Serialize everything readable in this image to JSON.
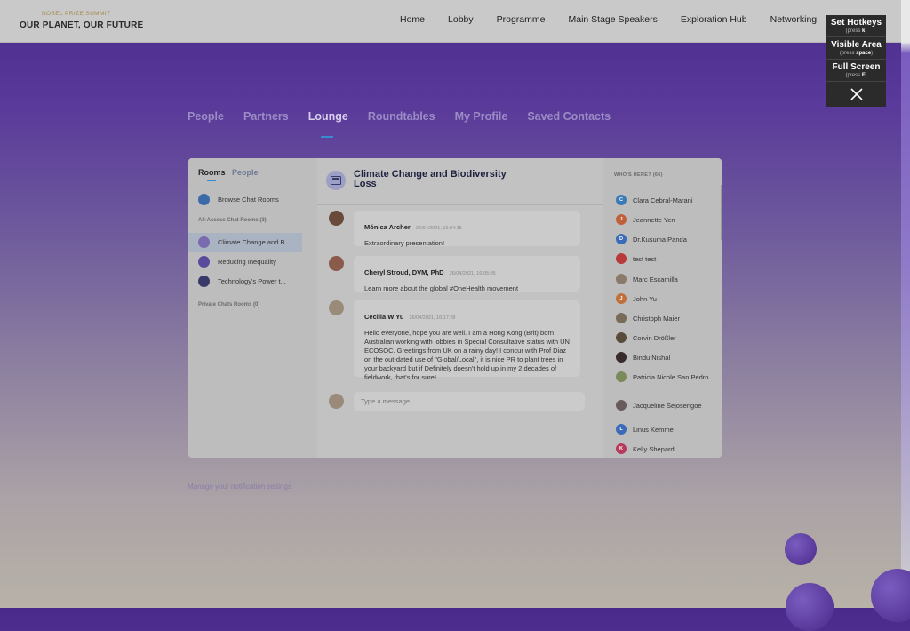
{
  "header": {
    "brand_sub": "NOBEL PRIZE SUMMIT",
    "brand_main": "OUR PLANET, OUR FUTURE",
    "nav": [
      "Home",
      "Lobby",
      "Programme",
      "Main Stage Speakers",
      "Exploration Hub",
      "Networking"
    ]
  },
  "hotkeys": {
    "set_title": "Set Hotkeys",
    "set_hint_pre": "(press ",
    "set_key": "k",
    "set_hint_post": ")",
    "visible_title": "Visible Area",
    "visible_hint_pre": "(press ",
    "visible_key": "space",
    "visible_hint_post": ")",
    "full_title": "Full Screen",
    "full_hint_pre": "(press ",
    "full_key": "F",
    "full_hint_post": ")"
  },
  "tabs": [
    "People",
    "Partners",
    "Lounge",
    "Roundtables",
    "My Profile",
    "Saved Contacts"
  ],
  "sidebar": {
    "rooms_tab": "Rooms",
    "people_tab": "People",
    "browse": "Browse Chat Rooms",
    "all_access": "All-Access Chat Rooms (3)",
    "rooms": [
      "Climate Change and B...",
      "Reducing Inequality",
      "Technology's Power t..."
    ],
    "private": "Private Chats Rooms (0)"
  },
  "chat": {
    "title": "Climate Change and Biodiversity Loss",
    "messages": [
      {
        "name": "Mónica Archer",
        "time": "26/04/2021, 16:04:15",
        "text": "Extraordinary presentation!"
      },
      {
        "name": "Cheryl Stroud, DVM, PhD",
        "time": "26/04/2021, 16:05:05",
        "text": "Learn more about the global #OneHealth movement"
      },
      {
        "name": "Cecilia W Yu",
        "time": "26/04/2021, 16:17:28",
        "text": "Hello everyone, hope you are well. I am a Hong Kong (Brit) born Australian working with lobbies in Special Consultative status with UN ECOSOC. Greetings from UK on a rainy day! I concur with Prof Diaz on the out-dated use of \"Global/Local\", it is nice PR to plant trees in your backyard but if Definitely doesn't hold up in my 2 decades of fieldwork, that's for sure!"
      }
    ],
    "placeholder": "Type a message..."
  },
  "whos_here": {
    "label": "WHO'S HERE? (66)",
    "people": [
      "Clara Cebral-Marani",
      "Jeannette Yen",
      "Dr.Kusuma Panda",
      "test test",
      "Marc Escamilla",
      "John Yu",
      "Christoph Maier",
      "Corvin Drößler",
      "Bindu Nishal",
      "Patricia Nicole San Pedro",
      "Jacqueline Sejosengoe",
      "Linus Kemme",
      "Kelly Shepard"
    ],
    "initials": [
      "C",
      "J",
      "D",
      "",
      "",
      "J",
      "",
      "",
      "",
      "",
      "",
      "L",
      "K"
    ],
    "avatar_colors": [
      "#3a7ab8",
      "#c0603a",
      "#3a6ab8",
      "#b83a3a",
      "#8a7a6a",
      "#c0703a",
      "#7a6a5a",
      "#5a4a3a",
      "#3a2a2a",
      "#7a8a5a",
      "#6a5a5a",
      "#3a6ab8",
      "#b83a5a"
    ]
  },
  "footer_faded": "Manage your notification settings"
}
